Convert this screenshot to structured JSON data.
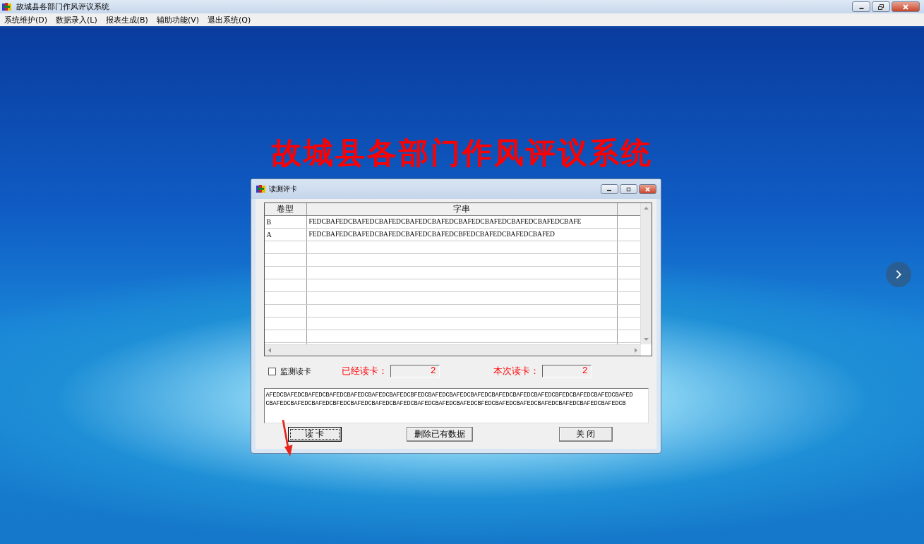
{
  "window": {
    "title": "故城县各部门作风评议系统"
  },
  "menu": [
    "系统维护(D)",
    "数据录入(L)",
    "报表生成(B)",
    "辅助功能(V)",
    "退出系统(Q)"
  ],
  "banner": "故城县各部门作风评议系统",
  "dialog": {
    "title": "读测评卡",
    "table": {
      "columns": [
        "卷型",
        "字串"
      ],
      "rows": [
        [
          "B",
          "FEDCBAFEDCBAFEDCBAFEDCBAFEDCBAFEDCBAFEDCBAFEDCBAFEDCBAFEDCBAFE"
        ],
        [
          "A",
          "FEDCBAFEDCBAFEDCBAFEDCBAFEDCBAFEDCBFEDCBAFEDCBAFEDCBAFED"
        ]
      ]
    },
    "monitor": {
      "label": "监测读卡",
      "checked": false
    },
    "read_total": {
      "label": "已经读卡：",
      "value": "2"
    },
    "read_now": {
      "label": "本次读卡：",
      "value": "2"
    },
    "log_lines": [
      "AFEDCBAFEDCBAFEDCBAFEDCBAFEDCBAFEDCBAFEDCBFEDCBAFEDCBAFEDCBAFEDCBAFEDCBAFEDCBAFEDCBFEDCBAFEDCBAFEDCBAFED",
      "CBAFEDCBAFEDCBAFEDCBFEDCBAFEDCBAFEDCBAFEDCBAFEDCBAFEDCBAFEDCBFEDCBAFEDCBAFEDCBAFEDCBAFEDCBAFEDCBAFEDCB"
    ],
    "buttons": [
      {
        "label": "读 卡",
        "focused": true
      },
      {
        "label": "删除已有数据",
        "focused": false
      },
      {
        "label": "关 闭",
        "focused": false
      }
    ]
  }
}
